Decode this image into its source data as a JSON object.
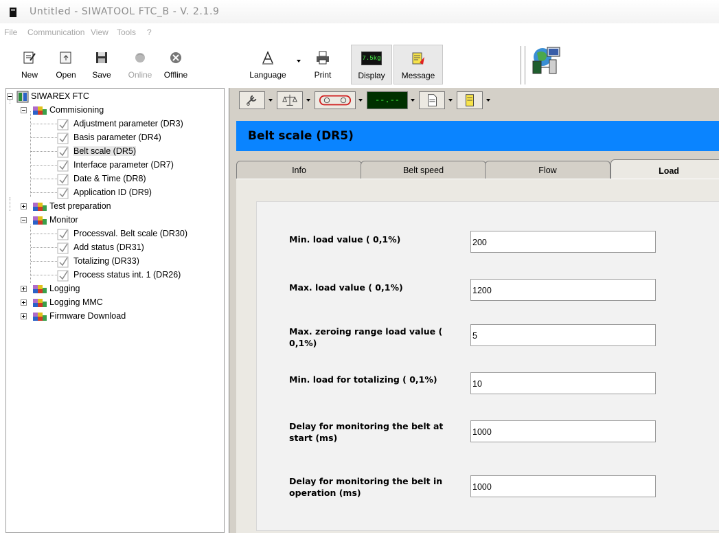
{
  "window": {
    "title": "Untitled - SIWATOOL FTC_B - V. 2.1.9"
  },
  "menu": [
    "File",
    "Communication",
    "View",
    "Tools",
    "?"
  ],
  "toolbar": {
    "new": "New",
    "open": "Open",
    "save": "Save",
    "online": "Online",
    "offline": "Offline",
    "language": "Language",
    "print": "Print",
    "display": "Display",
    "display_value": "7.5kg",
    "message": "Message"
  },
  "tree": {
    "root": "SIWAREX FTC",
    "commissioning": "Commisioning",
    "commissioning_items": [
      "Adjustment parameter (DR3)",
      "Basis parameter (DR4)",
      "Belt scale (DR5)",
      "Interface parameter (DR7)",
      "Date & Time (DR8)",
      "Application ID (DR9)"
    ],
    "test_preparation": "Test preparation",
    "monitor": "Monitor",
    "monitor_items": [
      "Processval. Belt scale (DR30)",
      "Add status (DR31)",
      "Totalizing (DR33)",
      "Process status int. 1 (DR26)"
    ],
    "logging": "Logging",
    "logging_mmc": "Logging MMC",
    "firmware_download": "Firmware Download"
  },
  "subtoolbar": {
    "display_value": "--.--"
  },
  "panel": {
    "header": "Belt scale (DR5)",
    "tabs": [
      "Info",
      "Belt speed",
      "Flow",
      "Load"
    ],
    "active_tab": "Load",
    "fields": [
      {
        "label": "Min. load value ( 0,1%)",
        "value": "200"
      },
      {
        "label": "Max. load value ( 0,1%)",
        "value": "1200"
      },
      {
        "label": "Max. zeroing range load value ( 0,1%)",
        "value": "5"
      },
      {
        "label": "Min. load for totalizing  ( 0,1%)",
        "value": "10"
      },
      {
        "label": "Delay for monitoring the belt at start (ms)",
        "value": "1000"
      },
      {
        "label": "Delay for monitoring the belt in operation (ms)",
        "value": "1000"
      }
    ]
  },
  "colors": {
    "header_bg": "#0a84ff",
    "panel_bg": "#d4d0c8",
    "content_bg": "#ebe9e3"
  }
}
